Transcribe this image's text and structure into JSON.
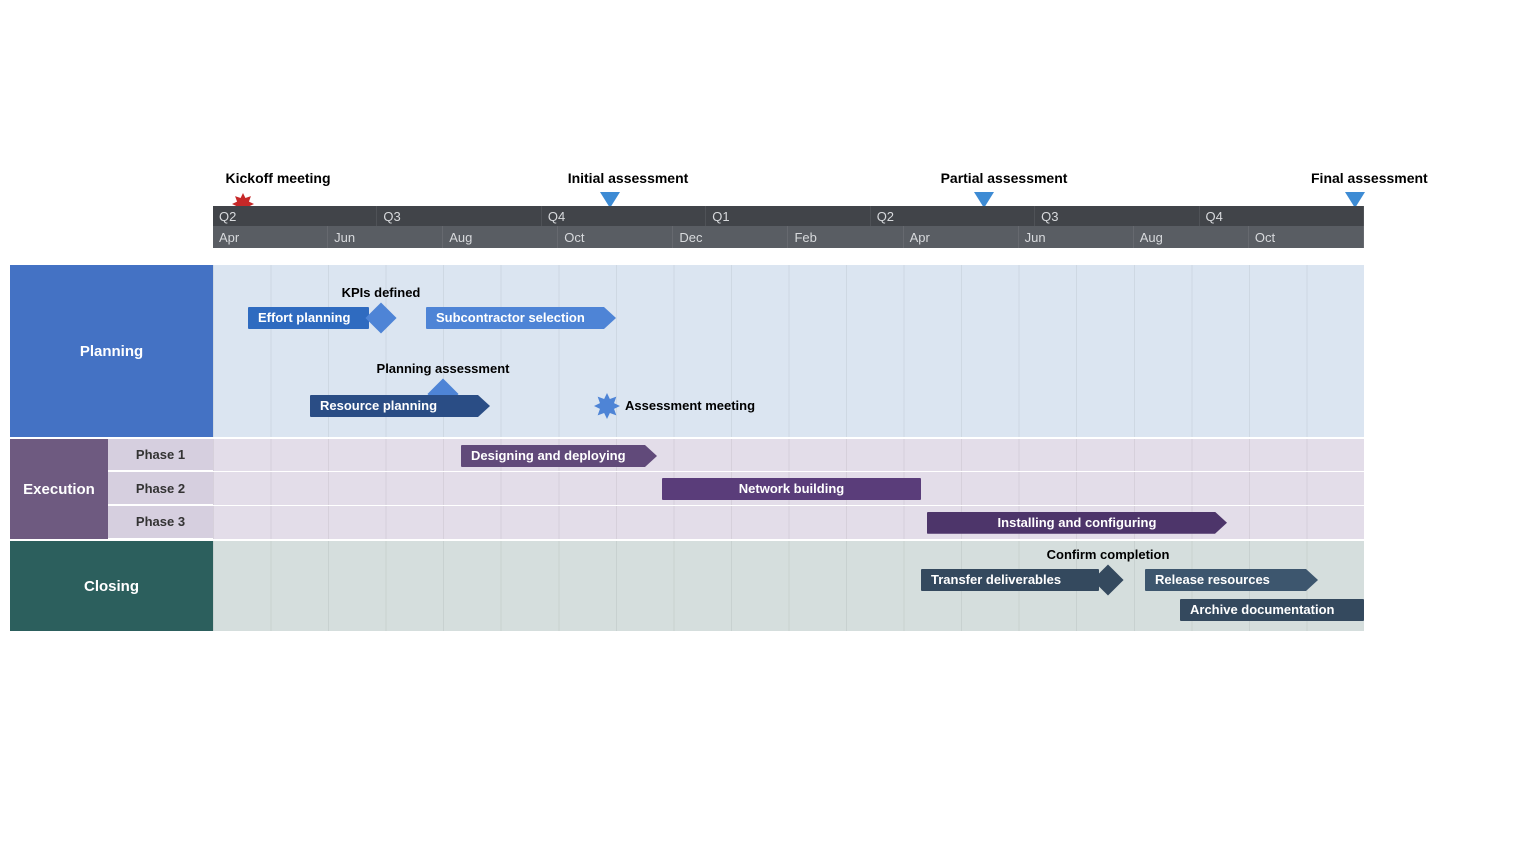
{
  "chart_data": {
    "type": "gantt",
    "title": "",
    "timeline": {
      "quarters": [
        "Q2",
        "Q3",
        "Q4",
        "Q1",
        "Q2",
        "Q3",
        "Q4"
      ],
      "months": [
        "Apr",
        "Jun",
        "Aug",
        "Oct",
        "Dec",
        "Feb",
        "Apr",
        "Jun",
        "Aug",
        "Oct"
      ],
      "start_month": "Apr",
      "total_months": 20,
      "milestones": [
        {
          "name": "Kickoff meeting",
          "month_index": 0.5,
          "marker": "burst"
        },
        {
          "name": "Initial assessment",
          "month_index": 6.9,
          "marker": "triangle"
        },
        {
          "name": "Partial assessment",
          "month_index": 13.4,
          "marker": "triangle"
        },
        {
          "name": "Final assessment",
          "month_index": 19.85,
          "marker": "triangle"
        }
      ]
    },
    "swimlanes": [
      {
        "name": "Planning",
        "color": "#4472c4",
        "tasks": [
          {
            "name": "Effort planning",
            "start": 0.6,
            "end": 2.7,
            "row": 0,
            "color": "#2f6bc0",
            "shape": "bar"
          },
          {
            "name": "KPIs defined",
            "type": "milestone",
            "at": 2.9,
            "row": 0,
            "color": "#4e84d6"
          },
          {
            "name": "Subcontractor selection",
            "start": 3.7,
            "end": 7.0,
            "row": 0,
            "color": "#4e84d6",
            "shape": "arrow"
          },
          {
            "name": "Resource planning",
            "start": 1.7,
            "end": 4.8,
            "row": 1,
            "color": "#2a4d85",
            "shape": "arrow"
          },
          {
            "name": "Planning assessment",
            "type": "milestone",
            "at": 4.0,
            "row": 1,
            "color": "#4e84d6"
          },
          {
            "name": "Assessment meeting",
            "type": "event",
            "at": 6.85,
            "row": 1,
            "color": "#4e84d6"
          }
        ]
      },
      {
        "name": "Execution",
        "color": "#6e5a80",
        "phases": [
          "Phase 1",
          "Phase 2",
          "Phase 3"
        ],
        "tasks": [
          {
            "name": "Designing and deploying",
            "start": 4.3,
            "end": 7.7,
            "phase": 0,
            "color": "#614a7a",
            "shape": "arrow"
          },
          {
            "name": "Network building",
            "start": 7.8,
            "end": 12.3,
            "phase": 1,
            "color": "#5a3d7a",
            "shape": "bar"
          },
          {
            "name": "Installing and configuring",
            "start": 12.4,
            "end": 17.6,
            "phase": 2,
            "color": "#4d356a",
            "shape": "arrow"
          }
        ]
      },
      {
        "name": "Closing",
        "color": "#2c5f5d",
        "tasks": [
          {
            "name": "Transfer deliverables",
            "start": 12.3,
            "end": 15.4,
            "row": 0,
            "color": "#34495e",
            "shape": "bar"
          },
          {
            "name": "Confirm completion",
            "type": "milestone",
            "at": 15.55,
            "row": 0,
            "color": "#34495e"
          },
          {
            "name": "Release resources",
            "start": 16.2,
            "end": 19.2,
            "row": 0,
            "color": "#3d566e",
            "shape": "arrow"
          },
          {
            "name": "Archive documentation",
            "start": 16.8,
            "end": 20.0,
            "row": 1,
            "color": "#34495e",
            "shape": "bar"
          }
        ]
      }
    ]
  },
  "labels": {
    "kickoff": "Kickoff meeting",
    "initial": "Initial assessment",
    "partial": "Partial assessment",
    "final": "Final assessment",
    "planning": "Planning",
    "execution": "Execution",
    "closing": "Closing",
    "phase1": "Phase 1",
    "phase2": "Phase 2",
    "phase3": "Phase 3",
    "effort": "Effort planning",
    "kpis": "KPIs defined",
    "subsel": "Subcontractor selection",
    "resplan": "Resource planning",
    "planasmt": "Planning assessment",
    "asmtmtg": "Assessment meeting",
    "design": "Designing and deploying",
    "network": "Network building",
    "install": "Installing and configuring",
    "transfer": "Transfer deliverables",
    "confirm": "Confirm completion",
    "release": "Release resources",
    "archive": "Archive documentation",
    "q": [
      "Q2",
      "Q3",
      "Q4",
      "Q1",
      "Q2",
      "Q3",
      "Q4"
    ],
    "m": [
      "Apr",
      "Jun",
      "Aug",
      "Oct",
      "Dec",
      "Feb",
      "Apr",
      "Jun",
      "Aug",
      "Oct"
    ]
  }
}
